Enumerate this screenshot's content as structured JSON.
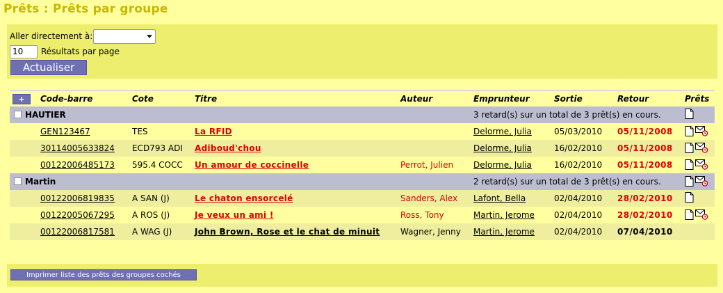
{
  "page": {
    "title": "Prêts : Prêts par groupe"
  },
  "form": {
    "goto_label": "Aller directement à:",
    "goto_value": "",
    "per_page_value": "10",
    "per_page_label": "Résultats par page",
    "update_button": "Actualiser"
  },
  "table": {
    "expand_button": "+",
    "headers": {
      "barcode": "Code-barre",
      "call_number": "Cote",
      "title": "Titre",
      "author": "Auteur",
      "borrower": "Emprunteur",
      "checkout": "Sortie",
      "due": "Retour",
      "loans": "Prêts"
    },
    "groups": [
      {
        "name": "HAUTIER",
        "summary": "3 retard(s) sur un total de 3 prêt(s) en cours.",
        "rows": [
          {
            "barcode": "GEN123467",
            "call_number": "TES",
            "title": "La RFID",
            "author": "",
            "borrower": "Delorme, Julia",
            "checkout": "05/03/2010",
            "due": "05/11/2008"
          },
          {
            "barcode": "30114005633824",
            "call_number": "ECD793 ADI",
            "title": "Adiboud'chou",
            "author": "",
            "borrower": "Delorme, Julia",
            "checkout": "16/02/2010",
            "due": "05/11/2008"
          },
          {
            "barcode": "00122006485173",
            "call_number": "595.4 COCC",
            "title": "Un amour de coccinelle",
            "author": "Perrot, Julien",
            "borrower": "Delorme, Julia",
            "checkout": "16/02/2010",
            "due": "05/11/2008"
          }
        ]
      },
      {
        "name": "Martin",
        "summary": "2 retard(s) sur un total de 3 prêt(s) en cours.",
        "rows": [
          {
            "barcode": "00122006819835",
            "call_number": "A SAN (J)",
            "title": "Le chaton ensorcelé",
            "author": "Sanders, Alex",
            "borrower": "Lafont, Bella",
            "checkout": "02/04/2010",
            "due": "28/02/2010"
          },
          {
            "barcode": "00122005067295",
            "call_number": "A ROS (J)",
            "title": "Je veux un ami !",
            "author": "Ross, Tony",
            "borrower": "Martin, Jerome",
            "checkout": "02/04/2010",
            "due": "28/02/2010"
          },
          {
            "barcode": "00122006817581",
            "call_number": "A WAG (J)",
            "title": "John Brown, Rose et le chat de minuit",
            "author": "Wagner, Jenny",
            "borrower": "Martin, Jerome",
            "checkout": "02/04/2010",
            "due": "07/04/2010"
          }
        ]
      }
    ]
  },
  "footer": {
    "print_button": "Imprimer liste des prêts des groupes cochés"
  },
  "colors": {
    "background": "#ffff9f",
    "panel": "#eeee6e",
    "overdue": "#e00000",
    "button": "#6f6fb4",
    "group_row": "#bdbdd2",
    "title": "#c9b800"
  }
}
